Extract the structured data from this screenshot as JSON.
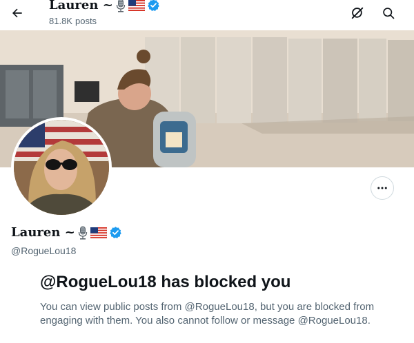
{
  "header": {
    "name": "Lauren ~",
    "post_count": "81.8K",
    "post_count_label": "posts"
  },
  "profile": {
    "name": "Lauren ~",
    "handle": "@RogueLou18"
  },
  "blocked": {
    "title": "@RogueLou18 has blocked you",
    "description": "You can view public posts from @RogueLou18, but you are blocked from engaging with them. You also cannot follow or message @RogueLou18."
  },
  "icons": {
    "back": "arrow-left-icon",
    "grok": "grok-icon",
    "search": "search-icon",
    "more": "more-dots-icon",
    "microphone": "microphone-emoji",
    "flag": "us-flag-emoji",
    "verified": "verified-badge-icon"
  },
  "colors": {
    "text_primary": "#0f1419",
    "text_secondary": "#536471",
    "verified_blue": "#1d9bf0",
    "border": "#cfd9de"
  }
}
